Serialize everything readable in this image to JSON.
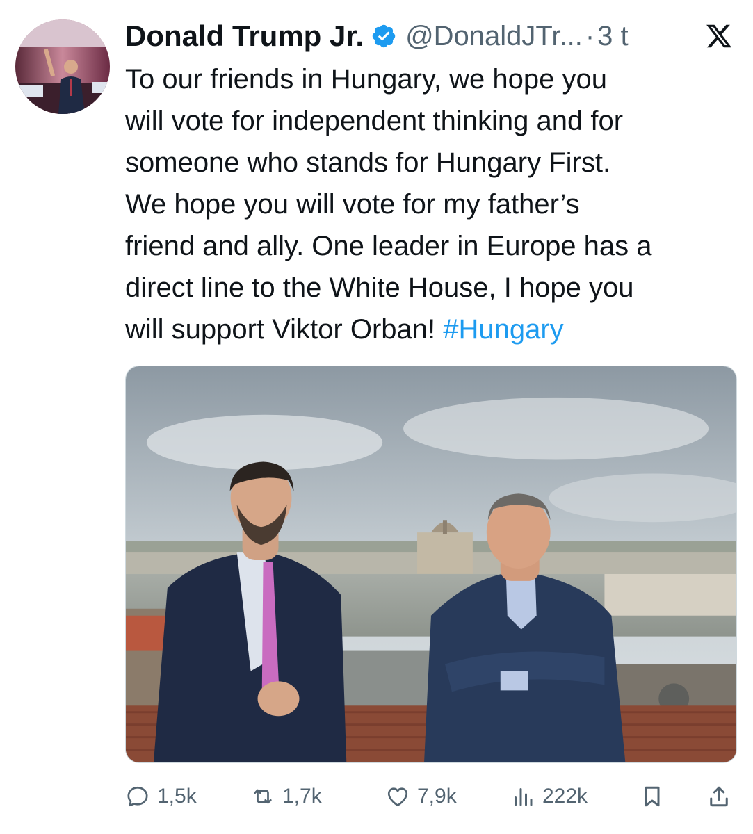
{
  "author": {
    "display_name": "Donald Trump Jr.",
    "handle": "@DonaldJTr...",
    "separator": "·",
    "timestamp": "3 t",
    "verified": true,
    "verified_color": "#1d9bf0",
    "avatar_icon": "profile-photo"
  },
  "platform_logo": "x-logo",
  "tweet": {
    "lines": [
      "To our friends in Hungary, we hope you",
      "will vote for independent thinking and for",
      "someone who stands for Hungary First.",
      "We hope you will vote for my father’s",
      "friend and ally. One leader in Europe has a",
      "direct line to the White House, I hope you",
      "will support Viktor Orban! "
    ],
    "hashtag": "#Hungary",
    "hashtag_color": "#1d9bf0"
  },
  "media": {
    "type": "photo",
    "description_icon": "photo-two-men-on-rooftop-budapest"
  },
  "actions": {
    "reply": {
      "icon": "reply-icon",
      "count": "1,5k"
    },
    "repost": {
      "icon": "repost-icon",
      "count": "1,7k"
    },
    "like": {
      "icon": "heart-icon",
      "count": "7,9k"
    },
    "views": {
      "icon": "views-icon",
      "count": "222k"
    },
    "bookmark": {
      "icon": "bookmark-icon"
    },
    "share": {
      "icon": "share-icon"
    }
  },
  "colors": {
    "text": "#0f1419",
    "secondary": "#536471",
    "accent": "#1d9bf0"
  }
}
